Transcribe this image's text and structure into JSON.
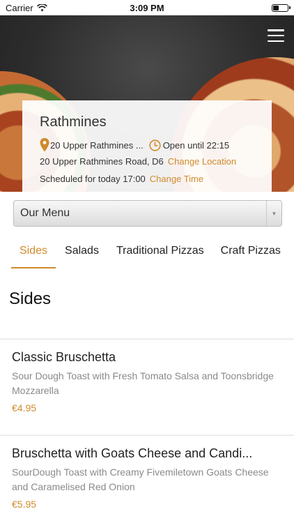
{
  "status_bar": {
    "carrier": "Carrier",
    "time": "3:09 PM"
  },
  "hero": {
    "menu_icon": "hamburger-menu-icon"
  },
  "store": {
    "name": "Rathmines",
    "address_short": "20 Upper Rathmines ...",
    "hours": "Open until 22:15",
    "address_full": "20 Upper Rathmines Road, D6",
    "change_location": "Change Location",
    "schedule": "Scheduled for today 17:00",
    "change_time": "Change Time"
  },
  "menu_select": {
    "value": "Our Menu"
  },
  "tabs": [
    {
      "label": "Sides",
      "active": true
    },
    {
      "label": "Salads",
      "active": false
    },
    {
      "label": "Traditional Pizzas",
      "active": false
    },
    {
      "label": "Craft Pizzas",
      "active": false
    }
  ],
  "section": {
    "title": "Sides"
  },
  "items": [
    {
      "name": "Classic Bruschetta",
      "description": "Sour Dough Toast with Fresh Tomato Salsa and Toonsbridge Mozzarella",
      "price": "€4.95"
    },
    {
      "name": "Bruschetta with Goats Cheese and Candi...",
      "description": "SourDough Toast with Creamy Fivemiletown Goats Cheese and Caramelised Red Onion",
      "price": "€5.95"
    }
  ],
  "colors": {
    "accent": "#d08a2c"
  }
}
